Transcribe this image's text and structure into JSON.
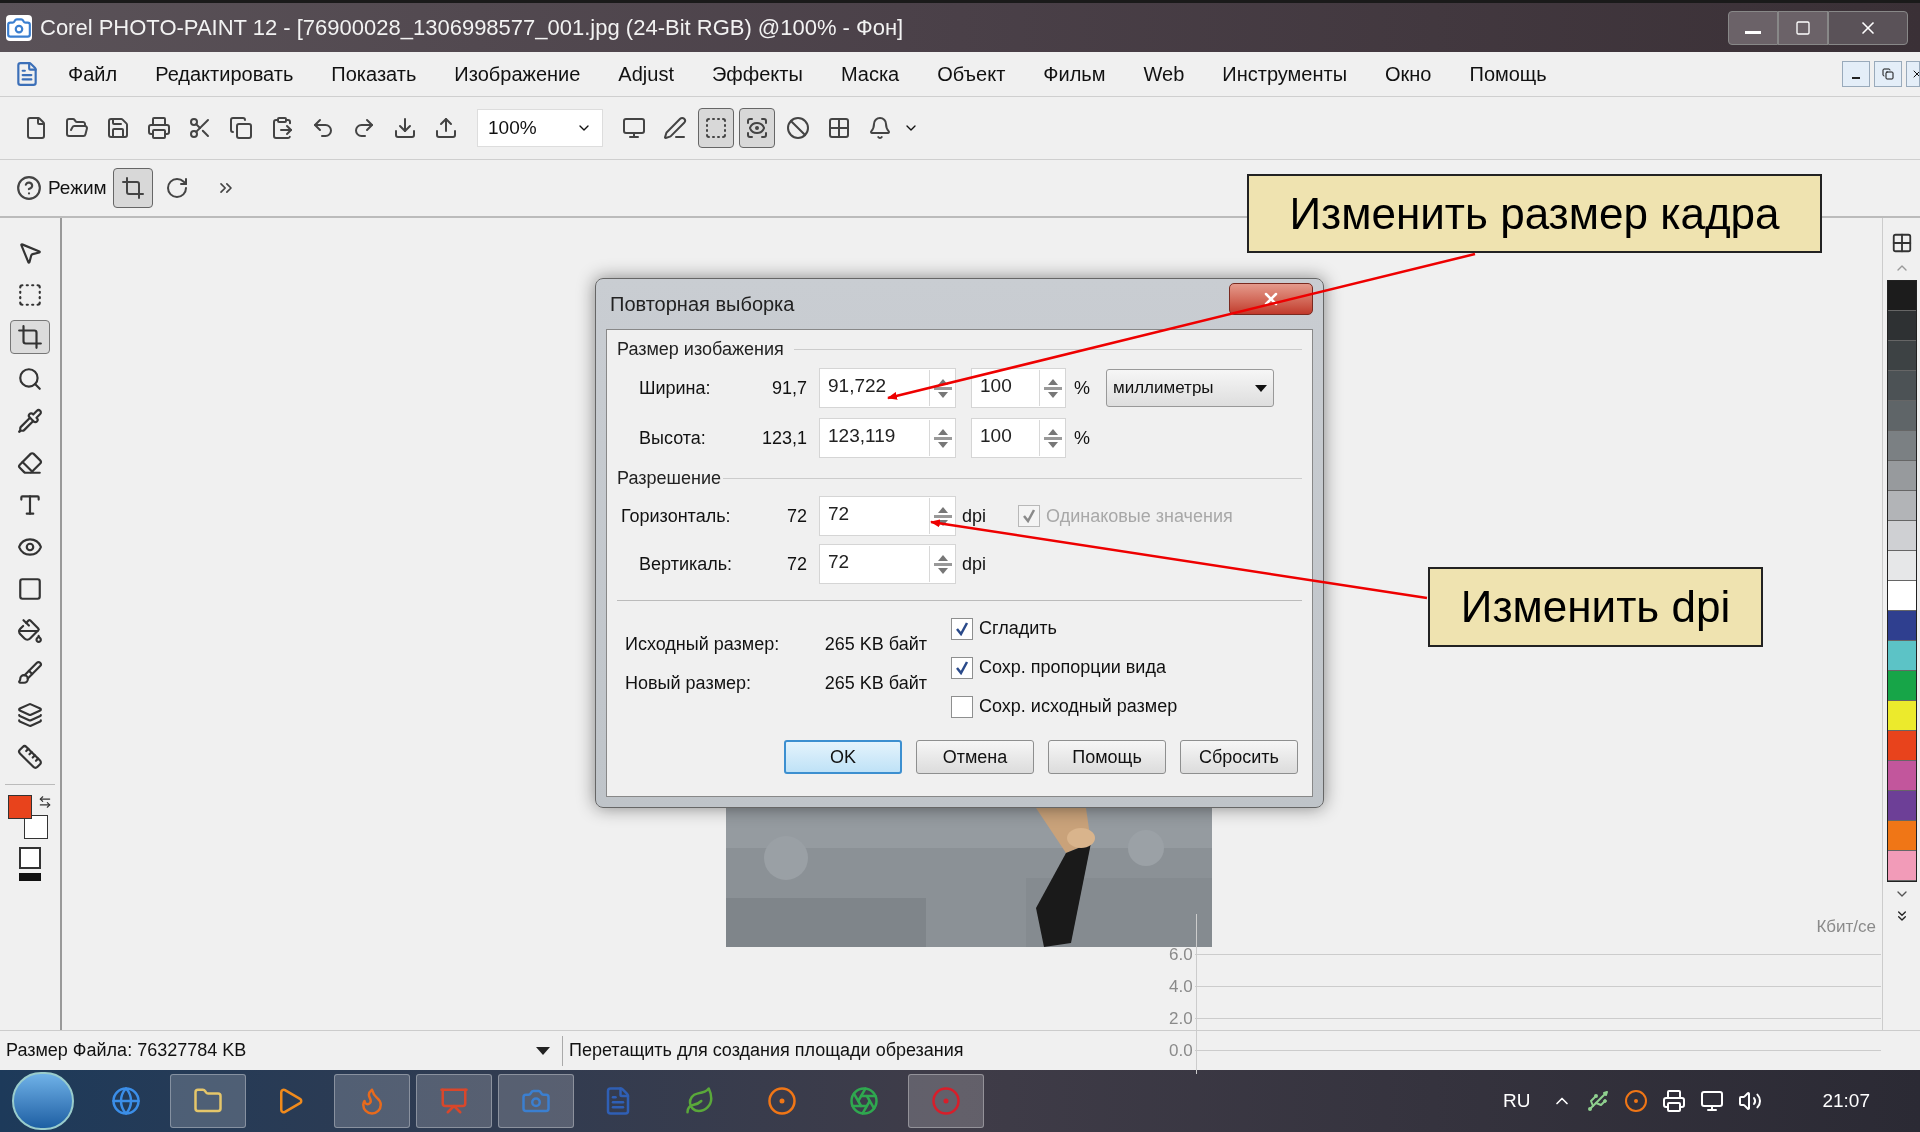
{
  "window": {
    "title": "Corel PHOTO-PAINT 12 - [76900028_1306998577_001.jpg (24-Bit RGB) @100% - Фон]"
  },
  "menu": [
    "Файл",
    "Редактировать",
    "Показать",
    "Изображение",
    "Adjust",
    "Эффекты",
    "Маска",
    "Объект",
    "Фильм",
    "Web",
    "Инструменты",
    "Окно",
    "Помощь"
  ],
  "toolbar": {
    "zoom": "100%",
    "buttons": [
      {
        "pressed": false
      },
      {
        "pressed": false
      },
      {
        "pressed": false
      },
      {
        "pressed": false
      },
      {
        "pressed": false
      },
      {
        "pressed": false
      },
      {
        "pressed": false
      },
      {
        "pressed": false
      },
      {
        "pressed": false
      },
      {
        "pressed": false
      },
      {
        "pressed": false
      },
      {
        "pressed": false
      },
      {
        "pressed": false
      },
      {
        "pressed": true
      },
      {
        "pressed": true
      },
      {
        "pressed": false
      },
      {
        "pressed": false
      },
      {
        "pressed": false
      }
    ]
  },
  "property_bar": {
    "mode_label": "Режим",
    "crop_pressed": true
  },
  "toolbox": [
    {
      "selected": false
    },
    {
      "selected": false
    },
    {
      "selected": true
    },
    {
      "selected": false
    },
    {
      "selected": false
    },
    {
      "selected": false
    },
    {
      "selected": false
    },
    {
      "selected": false
    },
    {
      "selected": false
    },
    {
      "selected": false
    },
    {
      "selected": false
    },
    {
      "selected": false
    },
    {
      "selected": false
    }
  ],
  "color_swatches": [
    {
      "color": "#e8431c"
    },
    {
      "color": "#ffffff"
    }
  ],
  "palette": [
    {
      "color": "#1c1c1c"
    },
    {
      "color": "#2e3133"
    },
    {
      "color": "#3d4244"
    },
    {
      "color": "#4c5255"
    },
    {
      "color": "#5f6568"
    },
    {
      "color": "#7b8083"
    },
    {
      "color": "#979a9d"
    },
    {
      "color": "#b2b4b7"
    },
    {
      "color": "#cfd0d3"
    },
    {
      "color": "#e6e7e8"
    },
    {
      "color": "#ffffff"
    },
    {
      "color": "#2f3f8f"
    },
    {
      "color": "#5cc3c6"
    },
    {
      "color": "#17a548"
    },
    {
      "color": "#ecea2c"
    },
    {
      "color": "#e8431c"
    },
    {
      "color": "#c2569c"
    },
    {
      "color": "#6d3f97"
    },
    {
      "color": "#f07616"
    },
    {
      "color": "#f29bb8"
    }
  ],
  "dialog": {
    "title": "Повторная выборка",
    "size_group": "Размер изобажения",
    "size_rows": [
      {
        "label": "Ширина:",
        "original": "91,7",
        "value": "91,722",
        "percent": "100",
        "percent_sign": "%"
      },
      {
        "label": "Высота:",
        "original": "123,1",
        "value": "123,119",
        "percent": "100",
        "percent_sign": "%"
      }
    ],
    "unit": "миллиметры",
    "resolution_group": "Разрешение",
    "resolution_rows": [
      {
        "label": "Горизонталь:",
        "original": "72",
        "value": "72",
        "unit": "dpi"
      },
      {
        "label": "Вертикаль:",
        "original": "72",
        "value": "72",
        "unit": "dpi"
      }
    ],
    "same_values": {
      "label": "Одинаковые значения",
      "checked": true,
      "disabled": true
    },
    "info": [
      {
        "label": "Исходный размер:",
        "value": "265 KB байт"
      },
      {
        "label": "Новый размер:",
        "value": "265 KB байт"
      }
    ],
    "options": [
      {
        "label": "Сгладить",
        "checked": true
      },
      {
        "label": "Сохр. пропорции вида",
        "checked": true
      },
      {
        "label": "Сохр. исходный размер",
        "checked": false
      }
    ],
    "buttons": [
      {
        "label": "OK",
        "selected": true
      },
      {
        "label": "Отмена",
        "selected": false
      },
      {
        "label": "Помощь",
        "selected": false
      },
      {
        "label": "Сбросить",
        "selected": false
      }
    ]
  },
  "graph_overlay": {
    "unit": "Кбит/се",
    "ticks": [
      "6.0",
      "4.0",
      "2.0",
      "0.0"
    ]
  },
  "status_bar": {
    "file_size": "Размер Файла: 76327784 KB",
    "hint": "Перетащить для создания площади обрезания"
  },
  "taskbar": {
    "language": "RU",
    "clock": "21:07"
  },
  "callouts": [
    "Изменить размер кадра",
    "Изменить dpi"
  ]
}
